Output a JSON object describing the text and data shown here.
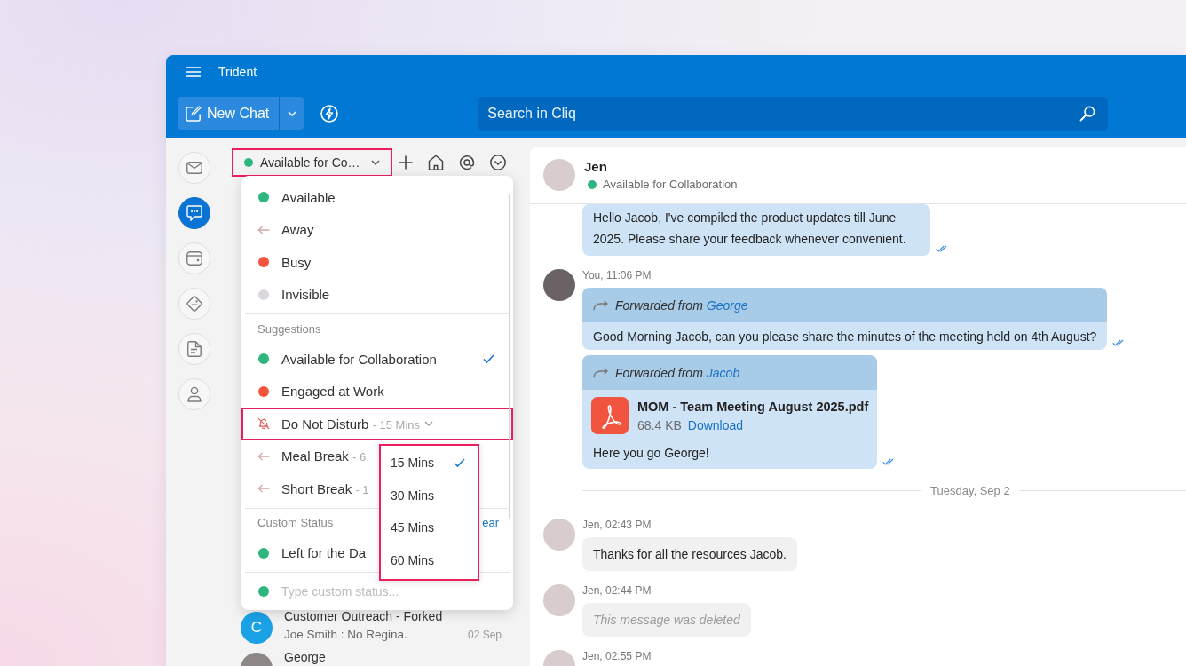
{
  "window": {
    "title": "Trident"
  },
  "toolbar": {
    "new_chat": "New Chat",
    "search": {
      "placeholder": "Search in Cliq"
    }
  },
  "rail": [
    {
      "kind": "mail",
      "selected": false
    },
    {
      "kind": "chat",
      "selected": true
    },
    {
      "kind": "wallet",
      "selected": false
    },
    {
      "kind": "tag-check",
      "selected": false
    },
    {
      "kind": "document",
      "selected": false
    },
    {
      "kind": "person",
      "selected": false
    }
  ],
  "status_selector": {
    "label": "Available for Co…",
    "highlighted": true
  },
  "chat_list": {
    "rows": [
      {
        "kind": "letter",
        "initial": "C",
        "title": "Customer Outreach - Forked",
        "preview": "Joe Smith : No Regina.",
        "time": "02 Sep"
      },
      {
        "kind": "photo",
        "title": "George"
      }
    ]
  },
  "status_menu": {
    "sections": [
      {
        "items": [
          {
            "kind": "dot",
            "color": "#2db67d",
            "label": "Available",
            "selected": false,
            "highlighted": false
          },
          {
            "kind": "arrow",
            "label": "Away",
            "selected": false,
            "highlighted": false
          },
          {
            "kind": "dot",
            "color": "#f4543c",
            "label": "Busy",
            "selected": false,
            "highlighted": false
          },
          {
            "kind": "dot",
            "color": "#dcd7df",
            "label": "Invisible",
            "selected": false,
            "highlighted": false
          }
        ]
      },
      {
        "heading": "Suggestions",
        "items": [
          {
            "kind": "dot",
            "color": "#2db67d",
            "label": "Available for Collaboration",
            "selected": true,
            "highlighted": false
          },
          {
            "kind": "dot",
            "color": "#f4543c",
            "label": "Engaged at Work",
            "selected": false,
            "highlighted": false
          },
          {
            "kind": "bell-off",
            "label": "Do Not Disturb",
            "duration": "- 15 Mins",
            "selected": false,
            "highlighted": true,
            "submenu": {
              "highlighted": true,
              "items": [
                {
                  "label": "15 Mins",
                  "selected": true
                },
                {
                  "label": "30 Mins",
                  "selected": false
                },
                {
                  "label": "45 Mins",
                  "selected": false
                },
                {
                  "label": "60 Mins",
                  "selected": false
                }
              ]
            }
          },
          {
            "kind": "arrow",
            "label": "Meal Break",
            "duration": "- 6",
            "selected": false,
            "highlighted": false
          },
          {
            "kind": "arrow",
            "label": "Short Break",
            "duration": "- 1",
            "selected": false,
            "highlighted": false
          }
        ]
      },
      {
        "heading": "Custom Status",
        "action": "ear",
        "items": [
          {
            "kind": "dot",
            "color": "#2db67d",
            "label": "Left for the Da",
            "selected": false,
            "highlighted": false
          }
        ]
      }
    ],
    "custom_input": {
      "placeholder": "Type custom status..."
    }
  },
  "chat": {
    "header": {
      "name": "Jen",
      "status": "Available for Collaboration"
    },
    "messages": [
      {
        "kind": "text",
        "own": true,
        "read": true,
        "text": "Hello Jacob, I've compiled the product updates till June 2025. Please share your feedback whenever convenient."
      },
      {
        "kind": "forward",
        "own": true,
        "read": true,
        "meta": "You, 11:06 PM",
        "forward_label": "Forwarded from",
        "forward_from": "George",
        "text": "Good Morning Jacob, can you please share the minutes of the meeting held on 4th August?"
      },
      {
        "kind": "forward",
        "own": true,
        "read": true,
        "forward_label": "Forwarded from",
        "forward_from": "Jacob",
        "file": {
          "name": "MOM - Team Meeting August 2025.pdf",
          "size": "68.4 KB",
          "action": "Download"
        },
        "text": "Here you go George!"
      },
      {
        "kind": "date",
        "text": "Tuesday, Sep 2"
      },
      {
        "kind": "text",
        "own": false,
        "meta": "Jen, 02:43 PM",
        "text": "Thanks for all the resources Jacob."
      },
      {
        "kind": "deleted",
        "own": false,
        "meta": "Jen, 02:44 PM",
        "text": "This message was deleted"
      },
      {
        "kind": "text",
        "own": false,
        "meta": "Jen, 02:55 PM"
      }
    ]
  }
}
